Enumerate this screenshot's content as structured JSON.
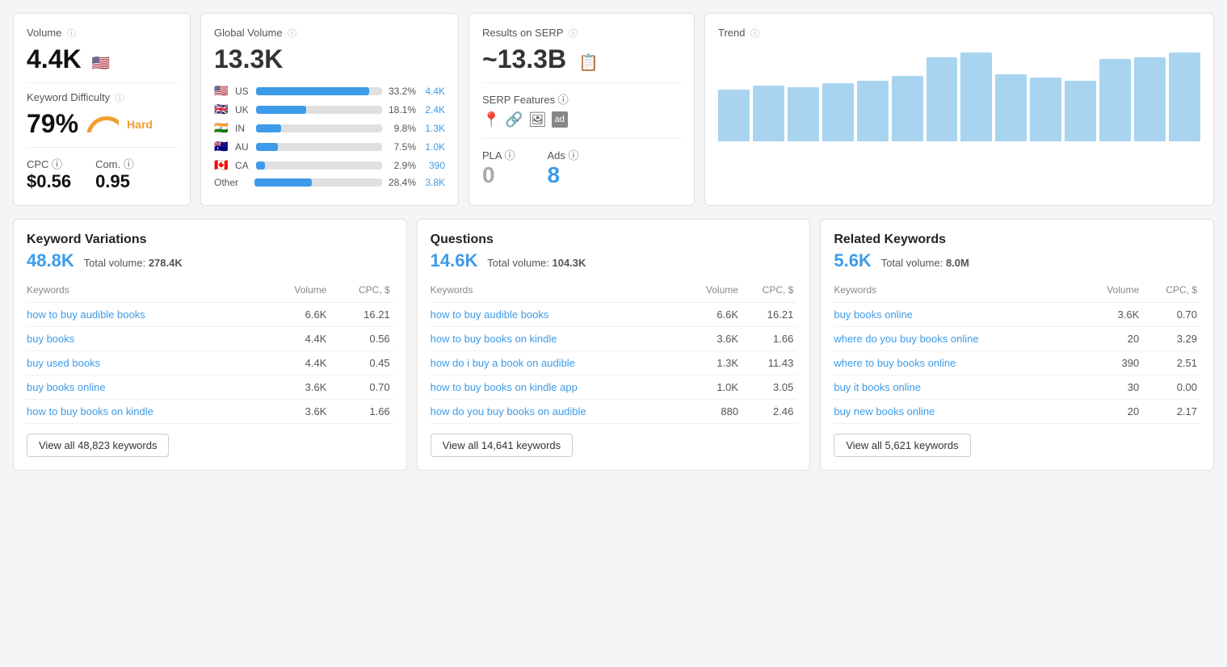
{
  "top": {
    "volume": {
      "label": "Volume",
      "value": "4.4K",
      "flag": "🇺🇸",
      "kd_label": "Keyword Difficulty",
      "kd_value": "79%",
      "kd_difficulty": "Hard",
      "cpc_label": "CPC",
      "cpc_value": "$0.56",
      "com_label": "Com.",
      "com_value": "0.95"
    },
    "global": {
      "label": "Global Volume",
      "value": "13.3K",
      "countries": [
        {
          "flag": "🇺🇸",
          "code": "US",
          "pct": "33.2%",
          "vol": "4.4K",
          "bar": 90
        },
        {
          "flag": "🇬🇧",
          "code": "UK",
          "pct": "18.1%",
          "vol": "2.4K",
          "bar": 40
        },
        {
          "flag": "🇮🇳",
          "code": "IN",
          "pct": "9.8%",
          "vol": "1.3K",
          "bar": 20
        },
        {
          "flag": "🇦🇺",
          "code": "AU",
          "pct": "7.5%",
          "vol": "1.0K",
          "bar": 17
        },
        {
          "flag": "🇨🇦",
          "code": "CA",
          "pct": "2.9%",
          "vol": "390",
          "bar": 7
        }
      ],
      "other_label": "Other",
      "other_pct": "28.4%",
      "other_vol": "3.8K",
      "other_bar": 45
    },
    "serp": {
      "label": "Results on SERP",
      "value": "~13.3B",
      "features_label": "SERP Features",
      "pla_label": "PLA",
      "pla_value": "0",
      "ads_label": "Ads",
      "ads_value": "8"
    },
    "trend": {
      "label": "Trend",
      "bars": [
        55,
        60,
        58,
        62,
        65,
        70,
        90,
        95,
        72,
        68,
        65,
        88,
        90,
        95
      ]
    }
  },
  "bottom": {
    "variations": {
      "title": "Keyword Variations",
      "count": "48.8K",
      "total_label": "Total volume:",
      "total_value": "278.4K",
      "col_keywords": "Keywords",
      "col_volume": "Volume",
      "col_cpc": "CPC, $",
      "rows": [
        {
          "keyword": "how to buy audible books",
          "volume": "6.6K",
          "cpc": "16.21"
        },
        {
          "keyword": "buy books",
          "volume": "4.4K",
          "cpc": "0.56"
        },
        {
          "keyword": "buy used books",
          "volume": "4.4K",
          "cpc": "0.45"
        },
        {
          "keyword": "buy books online",
          "volume": "3.6K",
          "cpc": "0.70"
        },
        {
          "keyword": "how to buy books on kindle",
          "volume": "3.6K",
          "cpc": "1.66"
        }
      ],
      "view_all_label": "View all 48,823 keywords"
    },
    "questions": {
      "title": "Questions",
      "count": "14.6K",
      "total_label": "Total volume:",
      "total_value": "104.3K",
      "col_keywords": "Keywords",
      "col_volume": "Volume",
      "col_cpc": "CPC, $",
      "rows": [
        {
          "keyword": "how to buy audible books",
          "volume": "6.6K",
          "cpc": "16.21"
        },
        {
          "keyword": "how to buy books on kindle",
          "volume": "3.6K",
          "cpc": "1.66"
        },
        {
          "keyword": "how do i buy a book on audible",
          "volume": "1.3K",
          "cpc": "11.43"
        },
        {
          "keyword": "how to buy books on kindle app",
          "volume": "1.0K",
          "cpc": "3.05"
        },
        {
          "keyword": "how do you buy books on audible",
          "volume": "880",
          "cpc": "2.46"
        }
      ],
      "view_all_label": "View all 14,641 keywords"
    },
    "related": {
      "title": "Related Keywords",
      "count": "5.6K",
      "total_label": "Total volume:",
      "total_value": "8.0M",
      "col_keywords": "Keywords",
      "col_volume": "Volume",
      "col_cpc": "CPC, $",
      "rows": [
        {
          "keyword": "buy books online",
          "volume": "3.6K",
          "cpc": "0.70"
        },
        {
          "keyword": "where do you buy books online",
          "volume": "20",
          "cpc": "3.29"
        },
        {
          "keyword": "where to buy books online",
          "volume": "390",
          "cpc": "2.51"
        },
        {
          "keyword": "buy it books online",
          "volume": "30",
          "cpc": "0.00"
        },
        {
          "keyword": "buy new books online",
          "volume": "20",
          "cpc": "2.17"
        }
      ],
      "view_all_label": "View all 5,621 keywords"
    }
  }
}
